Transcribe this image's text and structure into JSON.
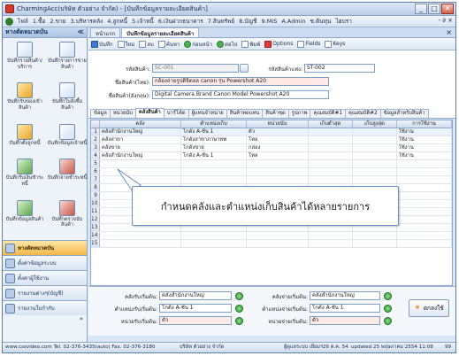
{
  "window": {
    "title": "CharmingAcc(บริษัท ตัวอย่าง จำกัด) - [บันทึกข้อมูลรายละเอียดสินค้า]",
    "controls": [
      "_",
      "□",
      "✕"
    ]
  },
  "menu": {
    "items": [
      "ไฟล์",
      "1.ซื้อ",
      "2.ขาย",
      "3.บริหารคลัง",
      "4.ลูกหนี้",
      "5.เจ้าหนี้",
      "6.เงินฝากธนาคาร",
      "7.สินทรัพย์",
      "8.บัญชี",
      "9.MIS",
      "A.Admin",
      "ช.ต้นทุน",
      "ไฮบรา"
    ],
    "right": "- ∂ ×"
  },
  "sidebar": {
    "header": "หางตัดหมวดบัน",
    "pin": "≪",
    "tiles": [
      {
        "label": "บันทึกรายสินค้า/บริการ",
        "icon": "document-icon"
      },
      {
        "label": "บันทึกรายการขายสินค้า",
        "icon": "invoice-icon"
      },
      {
        "label": "บันทึกรับของเข้าสินค้า",
        "icon": "box-icon"
      },
      {
        "label": "บันทึกใบสั่งซื้อสินค้า",
        "icon": "order-icon"
      },
      {
        "label": "บันทึกตั้งลูกหนี้",
        "icon": "folder-icon"
      },
      {
        "label": "บันทึกข้อมูลเจ้าหนี้",
        "icon": "person-icon"
      },
      {
        "label": "บันทึกรับเงินชำระหนี้",
        "icon": "cash-icon"
      },
      {
        "label": "บันทึกจ่ายชำระหนี้",
        "icon": "payment-icon"
      },
      {
        "label": "บันทึกข้อมูลสินค้า",
        "icon": "product-icon"
      },
      {
        "label": "บันทึกตรวจนับสินค้า",
        "icon": "stock-icon"
      }
    ],
    "bars": [
      {
        "label": "หางตัดหมวดบัน",
        "icon": "star-icon",
        "active": true
      },
      {
        "label": "ตั้งค่าข้อมูลระบบ",
        "icon": "settings-icon",
        "active": false
      },
      {
        "label": "ตั้งค่าผู้ใช้งาน",
        "icon": "users-icon",
        "active": false
      },
      {
        "label": "รายงานต่างๆ(บัญชี)",
        "icon": "report-icon",
        "active": false
      },
      {
        "label": "รายงานใบกำกับ",
        "icon": "print-icon",
        "active": false
      }
    ],
    "more": "»"
  },
  "doc_tabs": [
    {
      "label": "หน้าแรก",
      "active": false
    },
    {
      "label": "บันทึกข้อมูลรายละเอียดสินค้า",
      "active": true
    }
  ],
  "toolbar": {
    "items": [
      {
        "label": "บันทึก",
        "icon": "save-icon"
      },
      {
        "label": "ใหม่",
        "icon": "new-icon"
      },
      {
        "label": "ลบ",
        "icon": "delete-icon"
      },
      {
        "label": "ค้นหา",
        "icon": "search-icon"
      },
      {
        "label": "ก่อนหน้า",
        "icon": "prev-icon"
      },
      {
        "label": "ต่อไป",
        "icon": "next-icon"
      },
      {
        "label": "พิมพ์",
        "icon": "print-icon"
      },
      {
        "label": "Options",
        "icon": "options-icon"
      },
      {
        "label": "Fields",
        "icon": "fields-icon"
      },
      {
        "label": "Keys",
        "icon": "keys-icon"
      }
    ]
  },
  "form": {
    "code_label": "รหัสสินค้า:",
    "code_value": "SC-001",
    "extra_code_label": "รหัสสินค้าแท่ง:",
    "extra_code_value": "ST-002",
    "name_th_label": "ชื่อสินค้า(ไทย):",
    "name_th_value": "กล้องถ่ายรูปดิจิตอล canon รุ่น Powershot A20",
    "name_en_label": "ชื่อสินค้า(อังกฤษ):",
    "name_en_value": "Digital Camera Brand Canon Model Powershot A20"
  },
  "detail_tabs": [
    {
      "label": "ข้อมูล",
      "active": false
    },
    {
      "label": "หน่วยนับ",
      "active": false
    },
    {
      "label": "คลังสินค้า",
      "active": true
    },
    {
      "label": "บาร์โค้ด",
      "active": false
    },
    {
      "label": "ผู้แทนจำหน่าย",
      "active": false
    },
    {
      "label": "สินค้าทดแทน",
      "active": false
    },
    {
      "label": "สินค้าชุด",
      "active": false
    },
    {
      "label": "รูปภาพ",
      "active": false
    },
    {
      "label": "คุณสมบัติ#1",
      "active": false
    },
    {
      "label": "คุณสมบัติ#2",
      "active": false
    },
    {
      "label": "ข้อมูลสำหรับสินค้า",
      "active": false
    }
  ],
  "grid": {
    "columns": [
      "",
      "คลัง",
      "ตำแหน่งเก็บ",
      "หน่วยนับ",
      "เก็บต่ำสุด",
      "เก็บสูงสุด",
      "การใช้งาน"
    ],
    "rows": [
      {
        "n": "1",
        "cells": [
          "คลังสำนักงานใหญ่",
          "โกดัง A-ชั้น 1",
          "ตัว",
          "",
          "",
          "ใช้งาน"
        ]
      },
      {
        "n": "2",
        "cells": [
          "คลังสาขา",
          "โกดังสาขาภาษาทพ",
          "โหล",
          "",
          "",
          "ใช้งาน"
        ]
      },
      {
        "n": "3",
        "cells": [
          "คลังขาย",
          "โกดังขาย",
          "กล่อง",
          "",
          "",
          "ใช้งาน"
        ]
      },
      {
        "n": "4",
        "cells": [
          "คลังสำนักงานใหญ่",
          "โกดัง A-ชั้น 1",
          "โหล",
          "",
          "",
          "ใช้งาน"
        ]
      },
      {
        "n": "5",
        "cells": [
          "",
          "",
          "",
          "",
          "",
          ""
        ]
      },
      {
        "n": "6",
        "cells": [
          "",
          "",
          "",
          "",
          "",
          ""
        ]
      },
      {
        "n": "7",
        "cells": [
          "",
          "",
          "",
          "",
          "",
          ""
        ]
      },
      {
        "n": "8",
        "cells": [
          "",
          "",
          "",
          "",
          "",
          ""
        ]
      },
      {
        "n": "9",
        "cells": [
          "",
          "",
          "",
          "",
          "",
          ""
        ]
      },
      {
        "n": "10",
        "cells": [
          "",
          "",
          "",
          "",
          "",
          ""
        ]
      },
      {
        "n": "11",
        "cells": [
          "",
          "",
          "",
          "",
          "",
          ""
        ]
      },
      {
        "n": "12",
        "cells": [
          "",
          "",
          "",
          "",
          "",
          ""
        ]
      },
      {
        "n": "13",
        "cells": [
          "",
          "",
          "",
          "",
          "",
          ""
        ]
      },
      {
        "n": "14",
        "cells": [
          "",
          "",
          "",
          "",
          "",
          ""
        ]
      },
      {
        "n": "15",
        "cells": [
          "",
          "",
          "",
          "",
          "",
          ""
        ]
      }
    ]
  },
  "callout": {
    "text": "กำหนดคลังและตำแหน่งเก็บสินค้าได้หลายรายการ"
  },
  "bottom": {
    "recv_wh_label": "คลังรับเริ่มต้น:",
    "recv_wh_value": "คลังสำนักงานใหญ่",
    "issue_wh_label": "คลังจ่ายเริ่มต้น:",
    "issue_wh_value": "คลังสำนักงานใหญ่",
    "recv_loc_label": "ตำแหน่งรับเริ่มต้น:",
    "recv_loc_value": "โกดัง A-ชั้น 1",
    "issue_loc_label": "ตำแหน่งจ่ายเริ่มต้น:",
    "issue_loc_value": "โกดัง A-ชั้น 1",
    "recv_unit_label": "หน่วยรับเริ่มต้น:",
    "recv_unit_value": "ตัว",
    "issue_unit_label": "หน่วยจ่ายเริ่มต้น:",
    "issue_unit_value": "ตัว",
    "ok_label": "ตกลงใช้",
    "ok_icon": "star-icon"
  },
  "status": {
    "contact": "www.cssvideo.com Tel. 02-376-3435(auto) Fax. 02-376-3180",
    "company": "บริษัท ตัวอย่าง จำกัด",
    "user": "ผู้ดูแลระบบ เยี่ยมฯ",
    "date": "26 ต.ค. 54",
    "updated": "updated 25 พฤษภาคม 2554 11:08",
    "num": "99"
  }
}
